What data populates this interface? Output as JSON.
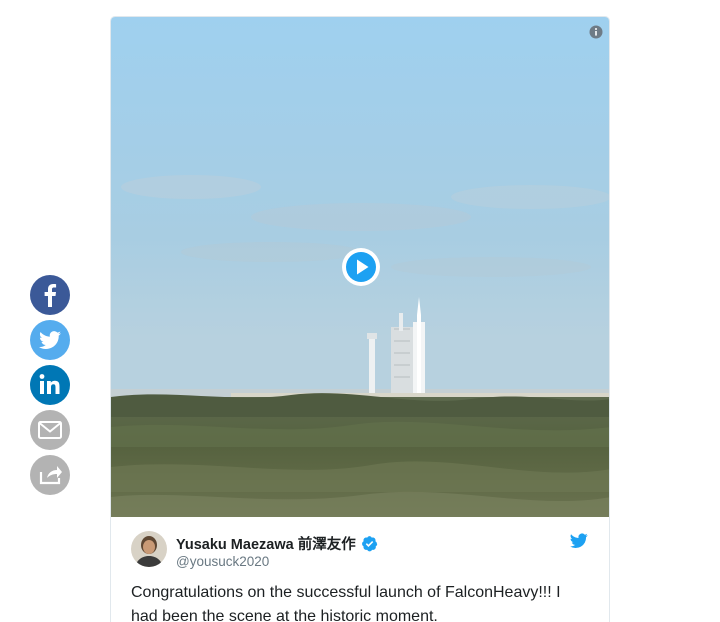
{
  "share": {
    "items": [
      {
        "name": "facebook",
        "icon": "facebook-icon",
        "color": "#3b5998"
      },
      {
        "name": "twitter",
        "icon": "twitter-icon",
        "color": "#55acee"
      },
      {
        "name": "linkedin",
        "icon": "linkedin-icon",
        "color": "#0077b5"
      },
      {
        "name": "email",
        "icon": "envelope-icon",
        "color": "#b3b3b3"
      },
      {
        "name": "share",
        "icon": "share-arrow-icon",
        "color": "#b3b3b3"
      }
    ]
  },
  "tweet": {
    "user_name": "Yusaku Maezawa 前澤友作",
    "user_handle": "@yousuck2020",
    "text": "Congratulations on the successful launch of FalconHeavy!!! I had been the scene at the historic moment.",
    "verified": true,
    "accent_color": "#1da1f2"
  },
  "media": {
    "type": "video",
    "play_icon": "play-icon",
    "info_icon": "info-icon"
  }
}
